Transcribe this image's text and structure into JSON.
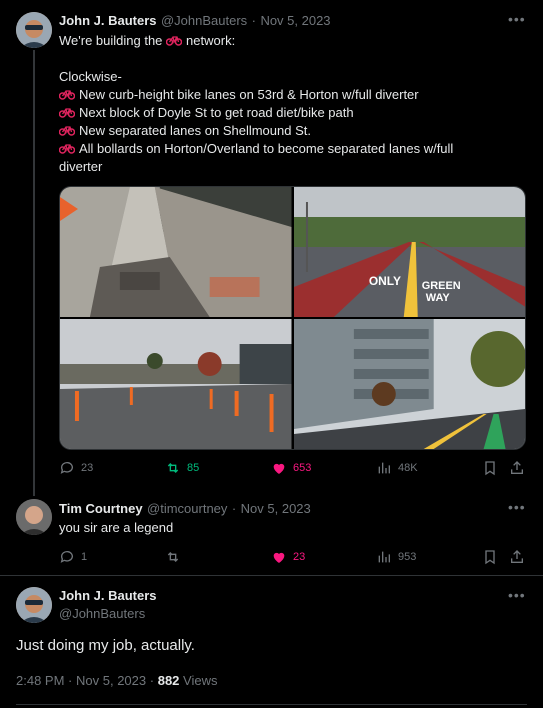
{
  "tweet1": {
    "author_name": "John J. Bauters",
    "handle": "@JohnBauters",
    "date": "Nov 5, 2023",
    "intro_before": "We're building the",
    "intro_after": "network:",
    "clockwise": "Clockwise-",
    "bullets": [
      "New curb-height bike lanes on 53rd & Horton w/full diverter",
      "Next block of Doyle St to get road diet/bike path",
      "New separated lanes on Shellmound St.",
      "All bollards on Horton/Overland to become separated lanes w/full"
    ],
    "bullet_continuation": "diverter",
    "stats": {
      "replies": "23",
      "reposts": "85",
      "likes": "653",
      "views": "48K"
    },
    "repost_color": "#00ba7c",
    "like_color": "#f91880",
    "street_text_1": "ONLY",
    "street_text_2": "GREEN",
    "street_text_3": "WAY"
  },
  "reply": {
    "author_name": "Tim Courtney",
    "handle": "@timcourtney",
    "date": "Nov 5, 2023",
    "text": "you sir are a legend",
    "stats": {
      "replies": "1",
      "likes": "23",
      "views": "953"
    }
  },
  "tweet2": {
    "author_name": "John J. Bauters",
    "handle": "@JohnBauters",
    "text": "Just doing my job, actually.",
    "time": "2:48 PM",
    "date": "Nov 5, 2023",
    "view_count": "882",
    "views_label": "Views"
  },
  "separator": "·",
  "icons": [
    "more-icon",
    "reply-icon",
    "repost-icon",
    "like-icon",
    "views-icon",
    "bookmark-icon",
    "share-icon",
    "bike-emoji-icon"
  ]
}
